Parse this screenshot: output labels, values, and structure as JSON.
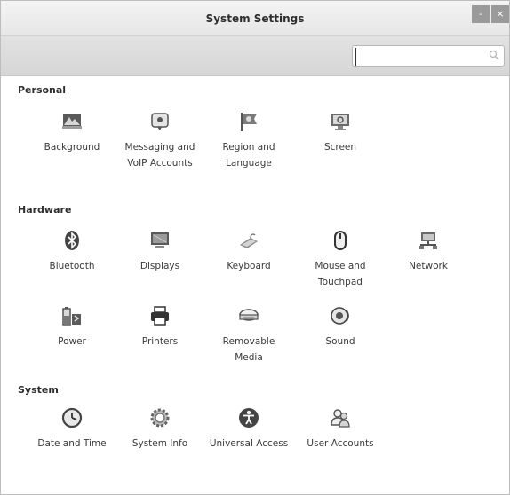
{
  "window": {
    "title": "System Settings",
    "controls": {
      "minimize": "-",
      "close": "×"
    }
  },
  "search": {
    "value": "",
    "placeholder": ""
  },
  "sections": [
    {
      "title": "Personal",
      "items": [
        {
          "label": "Background",
          "icon": "background-icon"
        },
        {
          "label": "Messaging and VoIP Accounts",
          "icon": "messaging-icon"
        },
        {
          "label": "Region and Language",
          "icon": "flag-icon"
        },
        {
          "label": "Screen",
          "icon": "screen-lock-icon"
        }
      ]
    },
    {
      "title": "Hardware",
      "items": [
        {
          "label": "Bluetooth",
          "icon": "bluetooth-icon"
        },
        {
          "label": "Displays",
          "icon": "display-icon"
        },
        {
          "label": "Keyboard",
          "icon": "keyboard-icon"
        },
        {
          "label": "Mouse and Touchpad",
          "icon": "mouse-icon"
        },
        {
          "label": "Network",
          "icon": "network-icon"
        },
        {
          "label": "Power",
          "icon": "battery-icon"
        },
        {
          "label": "Printers",
          "icon": "printer-icon"
        },
        {
          "label": "Removable Media",
          "icon": "removable-media-icon"
        },
        {
          "label": "Sound",
          "icon": "speaker-icon"
        }
      ]
    },
    {
      "title": "System",
      "items": [
        {
          "label": "Date and Time",
          "icon": "clock-icon"
        },
        {
          "label": "System Info",
          "icon": "gear-icon"
        },
        {
          "label": "Universal Access",
          "icon": "accessibility-icon"
        },
        {
          "label": "User Accounts",
          "icon": "users-icon"
        }
      ]
    }
  ]
}
